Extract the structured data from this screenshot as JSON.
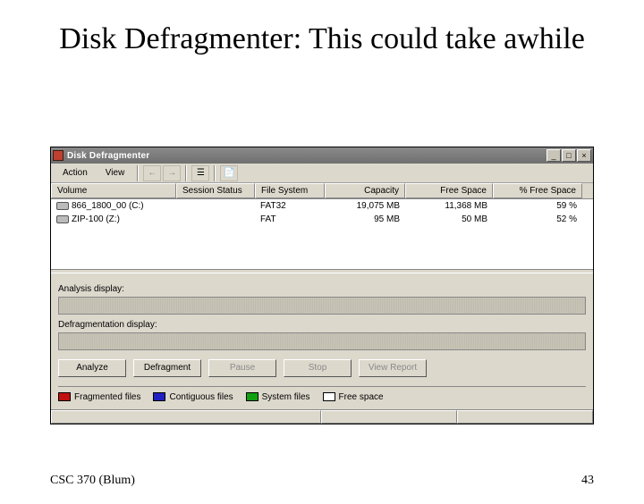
{
  "slide": {
    "title": "Disk Defragmenter: This could take awhile",
    "footer_left": "CSC 370 (Blum)",
    "footer_right": "43"
  },
  "app": {
    "title": "Disk Defragmenter",
    "menu": {
      "action": "Action",
      "view": "View"
    },
    "toolbar": {
      "back": "←",
      "forward": "→",
      "props": "☰",
      "help": "📄"
    },
    "columns": {
      "volume": "Volume",
      "session": "Session Status",
      "fs": "File System",
      "capacity": "Capacity",
      "free": "Free Space",
      "pct": "% Free Space"
    },
    "rows": [
      {
        "volume": "866_1800_00 (C:)",
        "session": "",
        "fs": "FAT32",
        "capacity": "19,075 MB",
        "free": "11,368 MB",
        "pct": "59 %"
      },
      {
        "volume": "ZIP-100 (Z:)",
        "session": "",
        "fs": "FAT",
        "capacity": "95 MB",
        "free": "50 MB",
        "pct": "52 %"
      }
    ],
    "labels": {
      "analysis": "Analysis display:",
      "defrag": "Defragmentation display:"
    },
    "buttons": {
      "analyze": "Analyze",
      "defragment": "Defragment",
      "pause": "Pause",
      "stop": "Stop",
      "view": "View Report"
    },
    "legend": {
      "frag": "Fragmented files",
      "contig": "Contiguous files",
      "system": "System files",
      "free": "Free space"
    },
    "colors": {
      "frag": "#c01010",
      "contig": "#2020c0",
      "system": "#10a010",
      "free": "#ffffff"
    }
  }
}
